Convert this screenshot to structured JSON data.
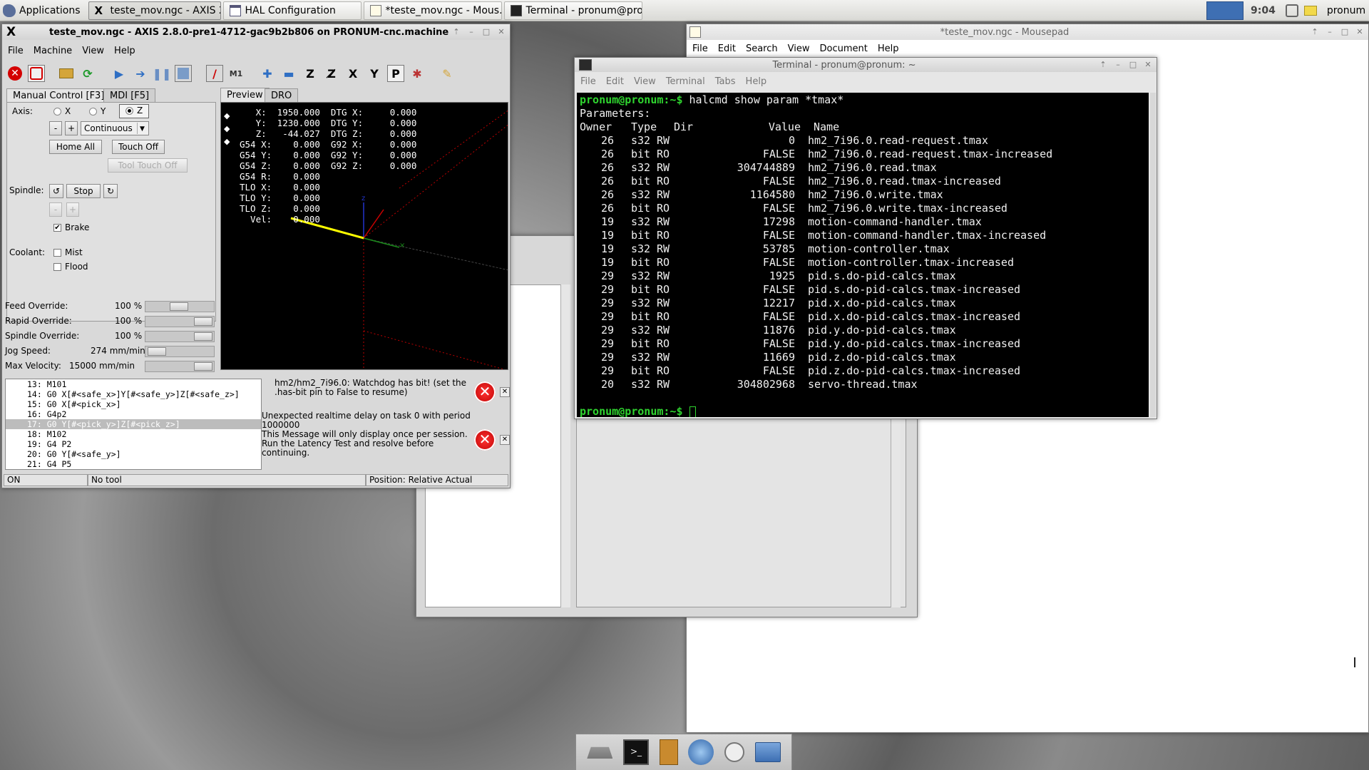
{
  "panel": {
    "apps_label": "Applications",
    "tasks": [
      {
        "label": "teste_mov.ngc - AXIS 2..."
      },
      {
        "label": "HAL Configuration"
      },
      {
        "label": "*teste_mov.ngc - Mous..."
      },
      {
        "label": "Terminal - pronum@pro..."
      }
    ],
    "clock": "9:04",
    "user": "pronum"
  },
  "mousepad": {
    "title": "*teste_mov.ngc - Mousepad",
    "menu": [
      "File",
      "Edit",
      "Search",
      "View",
      "Document",
      "Help"
    ]
  },
  "axis": {
    "title": "teste_mov.ngc - AXIS 2.8.0-pre1-4712-gac9b2b806 on PRONUM-cnc.machine",
    "menu": [
      "File",
      "Machine",
      "View",
      "Help"
    ],
    "tabs": {
      "manual": "Manual Control [F3]",
      "mdi": "MDI [F5]",
      "preview": "Preview",
      "dro": "DRO"
    },
    "axis_label": "Axis:",
    "axes": [
      "X",
      "Y",
      "Z"
    ],
    "selected_axis": "Z",
    "jog_minus": "-",
    "jog_plus": "+",
    "jog_mode": "Continuous",
    "home_all": "Home All",
    "touch_off": "Touch Off",
    "tool_touch_off": "Tool Touch Off",
    "spindle_label": "Spindle:",
    "spindle_stop": "Stop",
    "spindle_minus": "-",
    "spindle_plus": "+",
    "brake": "Brake",
    "coolant_label": "Coolant:",
    "mist": "Mist",
    "flood": "Flood",
    "overrides": [
      {
        "label": "Feed Override:",
        "value": "100 %",
        "level": 0.5
      },
      {
        "label": "Rapid Override:",
        "value": "100 %",
        "level": 1.0
      },
      {
        "label": "Spindle Override:",
        "value": "100 %",
        "level": 1.0
      },
      {
        "label": "Jog Speed:",
        "value": "274 mm/min",
        "level": 0.05
      },
      {
        "label": "Max Velocity:",
        "value": "15000 mm/min",
        "level": 1.0
      }
    ],
    "dro": [
      "   X:  1950.000  DTG X:     0.000",
      "   Y:  1230.000  DTG Y:     0.000",
      "   Z:   -44.027  DTG Z:     0.000",
      "G54 X:    0.000  G92 X:     0.000",
      "G54 Y:    0.000  G92 Y:     0.000",
      "G54 Z:    0.000  G92 Z:     0.000",
      "G54 R:    0.000",
      "TLO X:    0.000",
      "TLO Y:    0.000",
      "TLO Z:    0.000",
      "  Vel:    0.000"
    ],
    "gcode": [
      "13: M101",
      "14: G0 X[#<safe_x>]Y[#<safe_y>]Z[#<safe_z>]",
      "15: G0 X[#<pick_x>]",
      "16: G4p2",
      "17: G0 Y[#<pick_y>]Z[#<pick_z>]",
      "18: M102",
      "19: G4 P2",
      "20: G0 Y[#<safe_y>]",
      "21: G4 P5"
    ],
    "gcode_highlight": 4,
    "messages": [
      "hm2/hm2_7i96.0: Watchdog has bit! (set the .has-bit pin to False to resume)",
      "Unexpected realtime delay on task 0 with period 1000000\nThis Message will only display once per session.\nRun the Latency Test and resolve before continuing."
    ],
    "status": {
      "state": "ON",
      "tool": "No tool",
      "position": "Position: Relative Actual"
    }
  },
  "terminal": {
    "title": "Terminal - pronum@pronum: ~",
    "menu": [
      "File",
      "Edit",
      "View",
      "Terminal",
      "Tabs",
      "Help"
    ],
    "prompt": "pronum@pronum:~$",
    "command": " halcmd show param *tmax*",
    "params_header": "Parameters:",
    "columns": [
      "Owner",
      "Type",
      "Dir",
      "Value",
      "Name"
    ],
    "rows": [
      [
        "26",
        "s32",
        "RW",
        "0",
        "hm2_7i96.0.read-request.tmax"
      ],
      [
        "26",
        "bit",
        "RO",
        "FALSE",
        "hm2_7i96.0.read-request.tmax-increased"
      ],
      [
        "26",
        "s32",
        "RW",
        "304744889",
        "hm2_7i96.0.read.tmax"
      ],
      [
        "26",
        "bit",
        "RO",
        "FALSE",
        "hm2_7i96.0.read.tmax-increased"
      ],
      [
        "26",
        "s32",
        "RW",
        "1164580",
        "hm2_7i96.0.write.tmax"
      ],
      [
        "26",
        "bit",
        "RO",
        "FALSE",
        "hm2_7i96.0.write.tmax-increased"
      ],
      [
        "19",
        "s32",
        "RW",
        "17298",
        "motion-command-handler.tmax"
      ],
      [
        "19",
        "bit",
        "RO",
        "FALSE",
        "motion-command-handler.tmax-increased"
      ],
      [
        "19",
        "s32",
        "RW",
        "53785",
        "motion-controller.tmax"
      ],
      [
        "19",
        "bit",
        "RO",
        "FALSE",
        "motion-controller.tmax-increased"
      ],
      [
        "29",
        "s32",
        "RW",
        "1925",
        "pid.s.do-pid-calcs.tmax"
      ],
      [
        "29",
        "bit",
        "RO",
        "FALSE",
        "pid.s.do-pid-calcs.tmax-increased"
      ],
      [
        "29",
        "s32",
        "RW",
        "12217",
        "pid.x.do-pid-calcs.tmax"
      ],
      [
        "29",
        "bit",
        "RO",
        "FALSE",
        "pid.x.do-pid-calcs.tmax-increased"
      ],
      [
        "29",
        "s32",
        "RW",
        "11876",
        "pid.y.do-pid-calcs.tmax"
      ],
      [
        "29",
        "bit",
        "RO",
        "FALSE",
        "pid.y.do-pid-calcs.tmax-increased"
      ],
      [
        "29",
        "s32",
        "RW",
        "11669",
        "pid.z.do-pid-calcs.tmax"
      ],
      [
        "29",
        "bit",
        "RO",
        "FALSE",
        "pid.z.do-pid-calcs.tmax-increased"
      ],
      [
        "20",
        "s32",
        "RW",
        "304802968",
        "servo-thread.tmax"
      ]
    ]
  },
  "colors": {
    "prompt": "#2fd42f",
    "error": "#d40000",
    "highlight": "#bcbcbc"
  }
}
